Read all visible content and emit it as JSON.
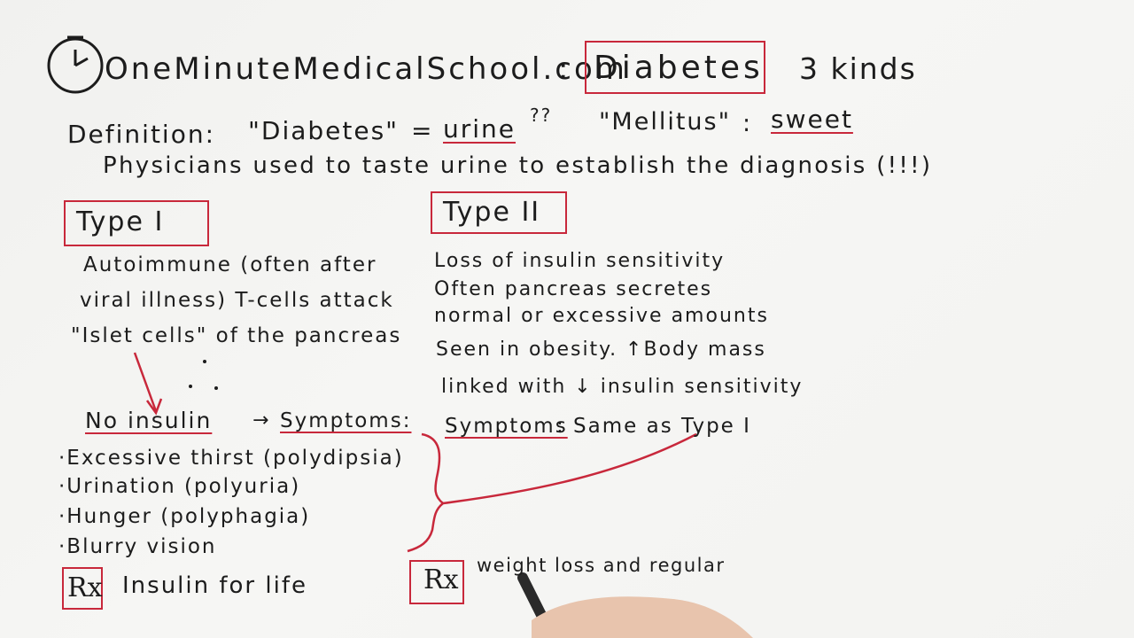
{
  "header": {
    "brand": "OneMinuteMedicalSchool.com",
    "colon": ":",
    "topic": "Diabetes",
    "kinds": "3 kinds"
  },
  "definition": {
    "label": "Definition:",
    "diabetes_word": "\"Diabetes\"",
    "equals": "=",
    "urine": "urine",
    "qmarks": "??",
    "mellitus_word": "\"Mellitus\"",
    "colon": ":",
    "sweet": "sweet",
    "history": "Physicians used to taste urine to establish the diagnosis (!!!)"
  },
  "type1": {
    "title": "Type I",
    "lines": [
      "Autoimmune (often after",
      "viral illness) T-cells attack",
      "\"Islet cells\" of the pancreas"
    ],
    "no_insulin": "No insulin",
    "arrow": "→",
    "symptoms_label": "Symptoms:",
    "symptoms": [
      "·Excessive thirst (polydipsia)",
      "·Urination (polyuria)",
      "·Hunger (polyphagia)",
      "·Blurry vision"
    ],
    "rx_symbol": "Rx",
    "treatment": "Insulin for life"
  },
  "type2": {
    "title": "Type II",
    "lines": [
      "Loss of insulin sensitivity",
      "Often pancreas secretes",
      "normal or excessive amounts",
      "Seen in obesity. ↑Body mass",
      "linked with ↓ insulin sensitivity"
    ],
    "symptoms_label": "Symptoms",
    "symptoms_text": ": Same as Type I",
    "rx_symbol": "Rx",
    "treatment": "weight loss and regular"
  },
  "colors": {
    "ink": "#1c1c1c",
    "red": "#c8283b",
    "board": "#f4f4f2"
  },
  "icons": [
    "clock-icon",
    "hand-with-marker"
  ]
}
